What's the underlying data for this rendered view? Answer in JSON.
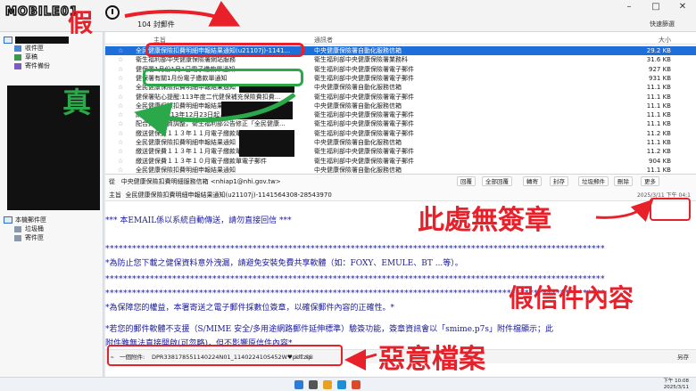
{
  "brand": {
    "logo_text": "MOBILE01"
  },
  "titlebar": {
    "message_count": "104 封郵件",
    "search_hint": "快速篩選",
    "minimize": "–",
    "maximize": "□",
    "close": "✕"
  },
  "folders": {
    "account_label": "本機新建",
    "items": [
      "收件匣",
      "草稿",
      "寄件備份"
    ],
    "local_label": "本機郵件匣",
    "local_items": [
      "垃圾桶",
      "寄件匣"
    ]
  },
  "list": {
    "headers": {
      "subject": "主旨",
      "from": "通訊者",
      "size": "大小"
    },
    "rows": [
      {
        "subject": "全民健康保險扣費明細申報結果通知(u21107j)-1141...",
        "from": "中央健康保險署自動化服務信箱",
        "size": "29.2 KB",
        "selected": true
      },
      {
        "subject": "衛生福利部中央健康保險署網站服務",
        "from": "衛生福利部中央健康保險署業務科",
        "size": "31.6 KB",
        "selected": false
      },
      {
        "subject": "健保署1月份1月1日電子繳款單通知",
        "from": "衛生福利部中央健康保險署電子郵件",
        "size": "927 KB",
        "selected": false
      },
      {
        "subject": "健保署有關1月份電子繳款單通知",
        "from": "衛生福利部中央健康保險署電子郵件",
        "size": "931 KB",
        "selected": false
      },
      {
        "subject": "全民健康保險扣費明細申報結果通知",
        "from": "中央健康保險署自動化服務信箱",
        "size": "11.1 KB",
        "selected": false
      },
      {
        "subject": "健保署貼心提醒:113年度二代健保補充保險費扣費...",
        "from": "衛生福利部中央健康保險署電子郵件",
        "size": "11.1 KB",
        "selected": false
      },
      {
        "subject": "全民健康保險扣費明細申報結果通知",
        "from": "中央健康保險署自動化服務信箱",
        "size": "11.1 KB",
        "selected": false
      },
      {
        "subject": "網路申辦【113年12月23日起，全民健康保...",
        "from": "衛生福利部中央健康保險署電子郵件",
        "size": "11.1 KB",
        "selected": false
      },
      {
        "subject": "配合員工工資調整，衛生福利部公告修正「全民健康...",
        "from": "衛生福利部中央健康保險署電子郵件",
        "size": "11.1 KB",
        "selected": false
      },
      {
        "subject": "繳送健保費１１３年１１月電子繳款單電子郵件",
        "from": "衛生福利部中央健康保險署電子郵件",
        "size": "11.2 KB",
        "selected": false
      },
      {
        "subject": "全民健康保險扣費明細申報結果通知",
        "from": "中央健康保險署自動化服務信箱",
        "size": "11.1 KB",
        "selected": false
      },
      {
        "subject": "繳送健保費１１３年１１月電子繳款單電子郵件",
        "from": "衛生福利部中央健康保險署電子郵件",
        "size": "11.2 KB",
        "selected": false
      },
      {
        "subject": "繳送健保費１１３年１０月電子繳款單電子郵件",
        "from": "衛生福利部中央健康保險署電子郵件",
        "size": "904 KB",
        "selected": false
      },
      {
        "subject": "全民健康保險扣費明細申報結果通知",
        "from": "中央健康保險署自動化服務信箱",
        "size": "11.1 KB",
        "selected": false
      },
      {
        "subject": "繳送健保費１１３年９月電子繳款單電子郵件",
        "from": "衛生福利部中央健康保險署電子郵件",
        "size": "11.8 KB",
        "selected": false
      }
    ]
  },
  "reader": {
    "from_label": "從",
    "from_value": "中央健康保險扣費明細服務信箱 <nhiap1@nhi.gov.tw>",
    "subject_label": "主旨",
    "subject_value": "全民健康保險扣費明細申報結果通知(u21107j)-1141564308-28543970",
    "date": "2025/3/11 下午 04:1",
    "toolbar": [
      "回覆",
      "全部回覆",
      "轉寄",
      "封存",
      "垃圾郵件",
      "刪除",
      "更多"
    ],
    "body_lines": [
      "*** 本EMAIL係以系統自動傳送，請勿直接回信 ***",
      "*為防止您下載之健保資料意外洩漏，請避免安裝免費共享軟體（如：FOXY、EMULE、BT ...等）。",
      "*為保障您的權益，本署寄送之電子郵件採數位簽章，以確保郵件內容的正確性。*",
      "*若您的郵件軟體不支援（S/MIME 安全/多用途網路郵件延伸標準）驗簽功能，簽章資訊會以「smime.p7s」附件檔顯示；此",
      "附件雖無法直接開啟(可忽略)，但不影響原信件內容*"
    ],
    "stars": "****************************************************************************************************************",
    "attachment": {
      "count": "一個附件:",
      "filename": "DPR338178551140224N01_114022410S452W♥pdf.zip",
      "size": "8.7 KB",
      "save": "另存"
    }
  },
  "annotations": {
    "fake": "假",
    "real": "真",
    "no_signature": "此處無簽章",
    "fake_content": "假信件內容",
    "malicious_file": "惡意檔案",
    "red": "#e8202a",
    "green": "#2aa84a"
  },
  "taskbar": {
    "time": "下午 10:08",
    "date": "2025/3/11"
  }
}
